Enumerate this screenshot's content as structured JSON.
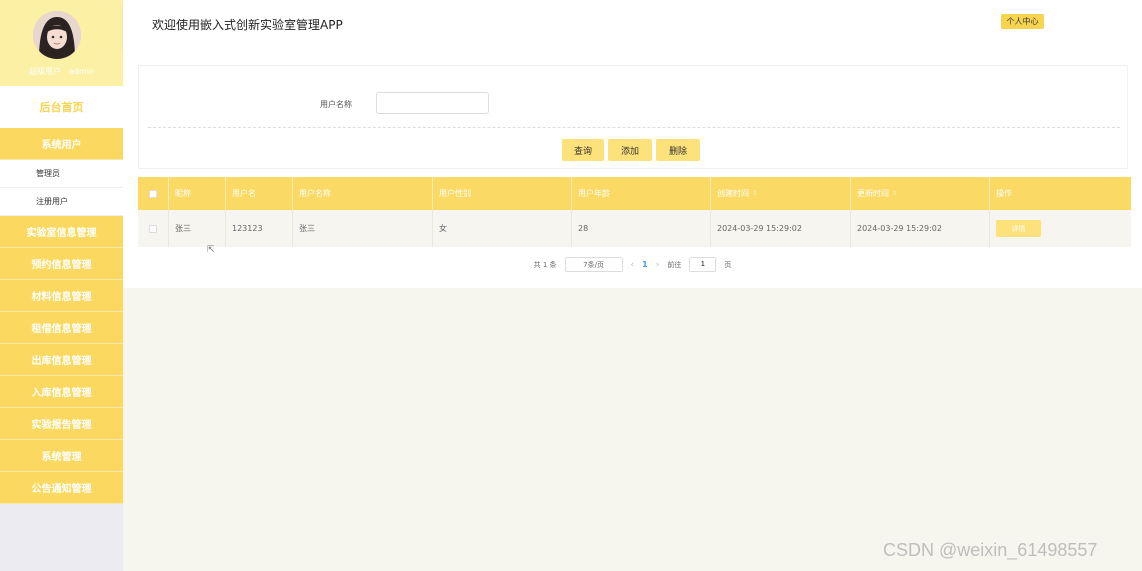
{
  "header": {
    "title": "欢迎使用嵌入式创新实验室管理APP",
    "personal_center": "个人中心"
  },
  "sidebar": {
    "user_info": "超级用户　admin",
    "home": "后台首页",
    "system_user": "系统用户",
    "sub_items": [
      "管理员",
      "注册用户"
    ],
    "items": [
      "实验室信息管理",
      "预约信息管理",
      "材料信息管理",
      "租借信息管理",
      "出库信息管理",
      "入库信息管理",
      "实验报告管理",
      "系统管理",
      "公告通知管理"
    ]
  },
  "search": {
    "label": "用户名称",
    "value": "",
    "query_btn": "查询",
    "add_btn": "添加",
    "delete_btn": "删除"
  },
  "table": {
    "columns": [
      "昵称",
      "用户名",
      "用户名称",
      "用户性别",
      "用户年龄",
      "创建时间",
      "更新时间",
      "操作"
    ],
    "rows": [
      {
        "nickname": "张三",
        "username": "123123",
        "name": "张三",
        "gender": "女",
        "age": "28",
        "created": "2024-03-29 15:29:02",
        "updated": "2024-03-29 15:29:02",
        "action": "详情"
      }
    ]
  },
  "pagination": {
    "total": "共 1 条",
    "page_size": "7条/页",
    "current_page": "1",
    "goto_label": "前往",
    "goto_value": "1",
    "page_unit": "页"
  },
  "watermark": "CSDN @weixin_61498557",
  "colors": {
    "accent": "#fad964",
    "sidebar_profile": "#fbf0a4"
  }
}
